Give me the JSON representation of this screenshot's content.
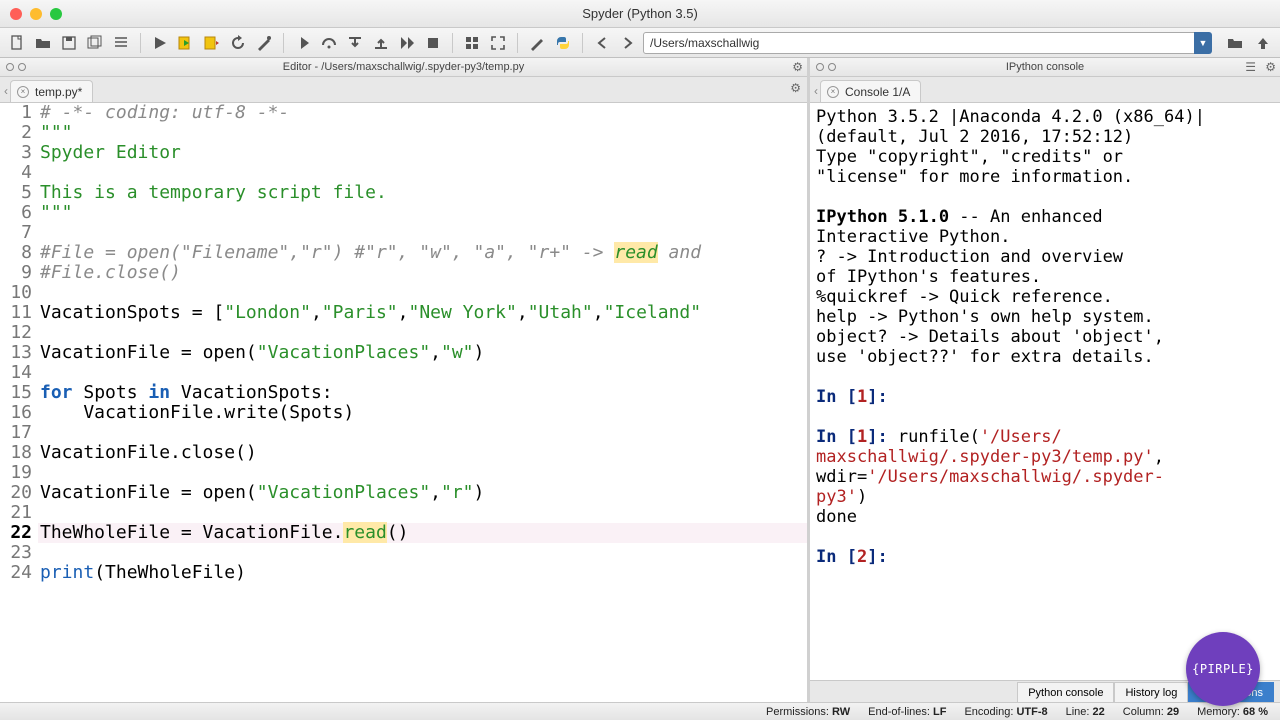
{
  "window": {
    "title": "Spyder (Python 3.5)"
  },
  "toolbar": {
    "path": "/Users/maxschallwig"
  },
  "editor_pane": {
    "title": "Editor - /Users/maxschallwig/.spyder-py3/temp.py",
    "tab": "temp.py*"
  },
  "console_pane": {
    "title": "IPython console",
    "tab": "Console 1/A"
  },
  "code": {
    "lines": [
      {
        "n": "1",
        "t": "comment",
        "text": "# -*- coding: utf-8 -*-"
      },
      {
        "n": "2",
        "t": "str",
        "text": "\"\"\""
      },
      {
        "n": "3",
        "t": "str",
        "text": "Spyder Editor"
      },
      {
        "n": "4",
        "t": "blank"
      },
      {
        "n": "5",
        "t": "str",
        "text": "This is a temporary script file."
      },
      {
        "n": "6",
        "t": "str",
        "text": "\"\"\""
      },
      {
        "n": "7",
        "t": "blank"
      },
      {
        "n": "8",
        "t": "comment_hl",
        "pre": "#File = open(\"Filename\",\"r\") #\"r\", \"w\", \"a\", \"r+\" -> ",
        "hl": "read",
        "post": " and"
      },
      {
        "n": "9",
        "t": "comment",
        "text": "#File.close()"
      },
      {
        "n": "10",
        "t": "blank"
      },
      {
        "n": "11",
        "t": "assign_list",
        "lhs": "VacationSpots = [",
        "items": [
          "\"London\"",
          "\"Paris\"",
          "\"New York\"",
          "\"Utah\"",
          "\"Iceland\""
        ]
      },
      {
        "n": "12",
        "t": "blank"
      },
      {
        "n": "13",
        "t": "open_w",
        "lhs": "VacationFile = ",
        "fn": "open",
        "a1": "\"VacationPlaces\"",
        "a2": "\"w\""
      },
      {
        "n": "14",
        "t": "blank"
      },
      {
        "n": "15",
        "t": "for",
        "pre": "for ",
        "var": "Spots",
        "mid": " in ",
        "iter": "VacationSpots:"
      },
      {
        "n": "16",
        "t": "call_indent",
        "obj": "VacationFile",
        "meth": "write",
        "arg": "Spots"
      },
      {
        "n": "17",
        "t": "blank"
      },
      {
        "n": "18",
        "t": "call",
        "obj": "VacationFile",
        "meth": "close",
        "arg": ""
      },
      {
        "n": "19",
        "t": "blank"
      },
      {
        "n": "20",
        "t": "open_w",
        "lhs": "VacationFile = ",
        "fn": "open",
        "a1": "\"VacationPlaces\"",
        "a2": "\"r\""
      },
      {
        "n": "21",
        "t": "blank"
      },
      {
        "n": "22",
        "t": "read",
        "lhs": "TheWholeFile = ",
        "obj": "VacationFile",
        "meth": "read",
        "cursor": true
      },
      {
        "n": "23",
        "t": "blank"
      },
      {
        "n": "24",
        "t": "print",
        "fn": "print",
        "arg": "TheWholeFile"
      }
    ]
  },
  "console": {
    "banner1": "Python 3.5.2 |Anaconda 4.2.0 (x86_64)|",
    "banner2": "(default, Jul  2 2016, 17:52:12)",
    "banner3": "Type \"copyright\", \"credits\" or",
    "banner4": "\"license\" for more information.",
    "ipy1": "IPython 5.1.0 -- An enhanced",
    "ipy2": "Interactive Python.",
    "h1": "?         -> Introduction and overview",
    "h1b": "of IPython's features.",
    "h2": "%quickref -> Quick reference.",
    "h3": "help      -> Python's own help system.",
    "h4": "object?   -> Details about 'object',",
    "h4b": "use 'object??' for extra details.",
    "in1_pre": "In [",
    "in1_n": "1",
    "in1_post": "]:",
    "in1b_pre": "In [",
    "in1b_n": "1",
    "in1b_post": "]: ",
    "runfile_a": "runfile(",
    "runfile_str": "'/Users/",
    "runfile_str2": "maxschallwig/.spyder-py3/temp.py'",
    "runfile_c": ",",
    "wdir_a": "wdir=",
    "wdir_s": "'/Users/maxschallwig/.spyder-",
    "wdir_s2": "py3'",
    "wdir_end": ")",
    "done": "done",
    "in2_pre": "In [",
    "in2_n": "2",
    "in2_post": "]:"
  },
  "bottom_tabs": [
    "Python console",
    "History log",
    "IPython cons"
  ],
  "status": {
    "perm_label": "Permissions:",
    "perm": "RW",
    "eol_label": "End-of-lines:",
    "eol": "LF",
    "enc_label": "Encoding:",
    "enc": "UTF-8",
    "line_label": "Line:",
    "line": "22",
    "col_label": "Column:",
    "col": "29",
    "mem_label": "Memory:",
    "mem": "68 %"
  },
  "badge": "{PIRPLE}"
}
